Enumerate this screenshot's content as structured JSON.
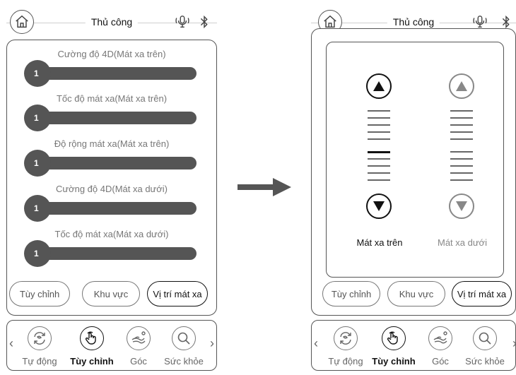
{
  "colors": {
    "dark": "#555555",
    "black": "#111111",
    "gray": "#777777",
    "light_gray": "#888888"
  },
  "left_screen": {
    "header": {
      "title": "Thủ công",
      "home_icon": "home-icon",
      "voice_icon": "voice-assistant-icon",
      "bt_icon": "bluetooth-icon"
    },
    "sliders": [
      {
        "label": "Cường độ 4D(Mát xa trên)",
        "value": "1"
      },
      {
        "label": "Tốc độ mát xa(Mát xa trên)",
        "value": "1"
      },
      {
        "label": "Độ rộng mát xa(Mát xa trên)",
        "value": "1"
      },
      {
        "label": "Cường độ 4D(Mát xa dưới)",
        "value": "1"
      },
      {
        "label": "Tốc độ mát xa(Mát xa dưới)",
        "value": "1"
      }
    ],
    "modes": [
      {
        "label": "Tùy chỉnh",
        "active": false
      },
      {
        "label": "Khu vực",
        "active": false
      },
      {
        "label": "Vị trí mát xa",
        "active": true
      }
    ],
    "nav": [
      {
        "label": "Tự động",
        "icon": "auto-cycle-icon",
        "active": false
      },
      {
        "label": "Tùy chỉnh",
        "icon": "hand-touch-icon",
        "active": true
      },
      {
        "label": "Góc",
        "icon": "recline-angle-icon",
        "active": false
      },
      {
        "label": "Sức khỏe",
        "icon": "search-health-icon",
        "active": false
      }
    ]
  },
  "right_screen": {
    "header": {
      "title": "Thủ công",
      "home_icon": "home-icon",
      "voice_icon": "voice-assistant-icon",
      "bt_icon": "bluetooth-icon"
    },
    "columns": [
      {
        "label": "Mát xa trên",
        "active": true,
        "levels": 10,
        "current_level": 5
      },
      {
        "label": "Mát xa dưới",
        "active": false,
        "levels": 10,
        "current_level": null
      }
    ],
    "modes": [
      {
        "label": "Tùy chỉnh",
        "active": false
      },
      {
        "label": "Khu vực",
        "active": false
      },
      {
        "label": "Vị trí mát xa",
        "active": true
      }
    ],
    "nav": [
      {
        "label": "Tự động",
        "icon": "auto-cycle-icon",
        "active": false
      },
      {
        "label": "Tùy chỉnh",
        "icon": "hand-touch-icon",
        "active": true
      },
      {
        "label": "Góc",
        "icon": "recline-angle-icon",
        "active": false
      },
      {
        "label": "Sức khỏe",
        "icon": "search-health-icon",
        "active": false
      }
    ]
  }
}
